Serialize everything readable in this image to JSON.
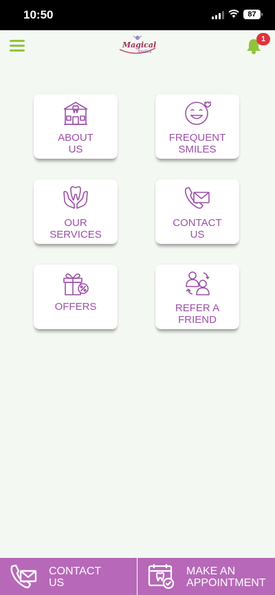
{
  "status_bar": {
    "time": "10:50",
    "battery": "87"
  },
  "header": {
    "logo_main": "Magical",
    "logo_sub": "Smiles",
    "notification_count": "1"
  },
  "tiles": [
    {
      "label_line1": "ABOUT",
      "label_line2": "US",
      "icon": "dental-clinic-building-icon"
    },
    {
      "label_line1": "FREQUENT",
      "label_line2": "SMILES",
      "icon": "smile-face-heart-icon"
    },
    {
      "label_line1": "OUR",
      "label_line2": "SERVICES",
      "icon": "tooth-hands-icon"
    },
    {
      "label_line1": "CONTACT",
      "label_line2": "US",
      "icon": "phone-envelope-icon"
    },
    {
      "label_line1": "OFFERS",
      "label_line2": "",
      "icon": "gift-discount-icon"
    },
    {
      "label_line1": "REFER A",
      "label_line2": "FRIEND",
      "icon": "refer-friend-icon"
    }
  ],
  "bottom_bar": {
    "contact_line1": "CONTACT",
    "contact_line2": "US",
    "appointment_line1": "MAKE AN",
    "appointment_line2": "APPOINTMENT"
  },
  "colors": {
    "accent": "#9b4fa6",
    "bottom_bar": "#b768b8",
    "menu_green": "#8fc33c",
    "badge_red": "#e0323c",
    "background": "#f4f8f2"
  }
}
